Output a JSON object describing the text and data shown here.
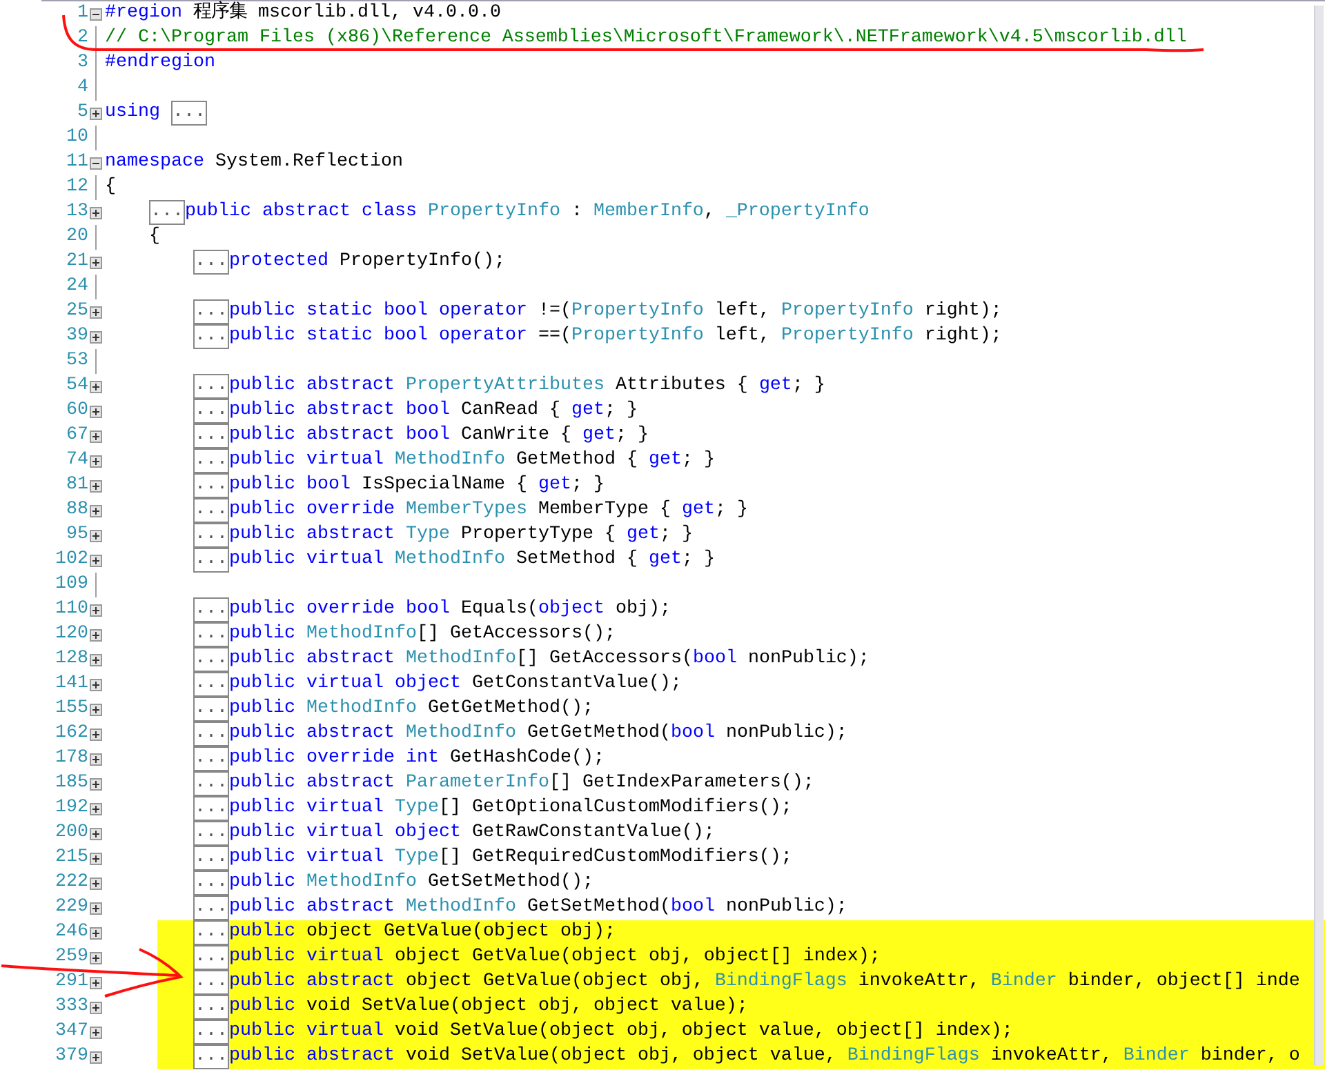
{
  "editor": {
    "lines": [
      {
        "number": "1",
        "expanded": true,
        "highlighted": false,
        "segments": [
          {
            "kind": "keyword",
            "text": "#region"
          },
          {
            "kind": "plain",
            "text": " 程序集 mscorlib.dll, v4.0.0.0"
          }
        ]
      },
      {
        "number": "2",
        "highlighted": false,
        "segments": [
          {
            "kind": "comment",
            "text": "// C:\\Program Files (x86)\\Reference Assemblies\\Microsoft\\Framework\\.NETFramework\\v4.5\\mscorlib.dll"
          }
        ]
      },
      {
        "number": "3",
        "highlighted": false,
        "segments": [
          {
            "kind": "keyword",
            "text": "#endregion"
          }
        ]
      },
      {
        "number": "4",
        "highlighted": false
      },
      {
        "number": "5",
        "expanded": false,
        "highlighted": false,
        "segments": [
          {
            "kind": "keyword",
            "text": "using "
          },
          {
            "kind": "collapsed",
            "text": "..."
          }
        ]
      },
      {
        "number": "10",
        "highlighted": false
      },
      {
        "number": "11",
        "expanded": true,
        "highlighted": false,
        "segments": [
          {
            "kind": "keyword",
            "text": "namespace"
          },
          {
            "kind": "plain",
            "text": " System.Reflection"
          }
        ]
      },
      {
        "number": "12",
        "highlighted": false,
        "segments": [
          {
            "kind": "plain",
            "text": "{"
          }
        ],
        "children": [
          {
            "number": "13",
            "expanded": false,
            "highlighted": false,
            "segments": [
              {
                "kind": "collapsed",
                "text": "..."
              },
              {
                "kind": "keyword",
                "text": "public abstract class "
              },
              {
                "kind": "type",
                "text": "PropertyInfo"
              },
              {
                "kind": "plain",
                "text": " : "
              },
              {
                "kind": "type",
                "text": "MemberInfo"
              },
              {
                "kind": "plain",
                "text": ", "
              },
              {
                "kind": "type",
                "text": "_PropertyInfo"
              }
            ]
          },
          {
            "number": "20",
            "highlighted": false,
            "segments": [
              {
                "kind": "plain",
                "text": "{"
              }
            ],
            "children": [
              {
                "number": "21",
                "expanded": false,
                "highlighted": false,
                "segments": [
                  {
                    "kind": "collapsed",
                    "text": "..."
                  },
                  {
                    "kind": "keyword",
                    "text": "protected"
                  },
                  {
                    "kind": "plain",
                    "text": " PropertyInfo();"
                  }
                ]
              },
              {
                "number": "24",
                "highlighted": false
              },
              {
                "number": "25",
                "expanded": false,
                "highlighted": false,
                "segments": [
                  {
                    "kind": "collapsed",
                    "text": "..."
                  },
                  {
                    "kind": "keyword",
                    "text": "public static bool operator"
                  },
                  {
                    "kind": "plain",
                    "text": " !=("
                  },
                  {
                    "kind": "type",
                    "text": "PropertyInfo"
                  },
                  {
                    "kind": "plain",
                    "text": " left, "
                  },
                  {
                    "kind": "type",
                    "text": "PropertyInfo"
                  },
                  {
                    "kind": "plain",
                    "text": " right);"
                  }
                ]
              },
              {
                "number": "39",
                "expanded": false,
                "highlighted": false,
                "segments": [
                  {
                    "kind": "collapsed",
                    "text": "..."
                  },
                  {
                    "kind": "keyword",
                    "text": "public static bool operator"
                  },
                  {
                    "kind": "plain",
                    "text": " ==("
                  },
                  {
                    "kind": "type",
                    "text": "PropertyInfo"
                  },
                  {
                    "kind": "plain",
                    "text": " left, "
                  },
                  {
                    "kind": "type",
                    "text": "PropertyInfo"
                  },
                  {
                    "kind": "plain",
                    "text": " right);"
                  }
                ]
              },
              {
                "number": "53",
                "highlighted": false
              },
              {
                "number": "54",
                "expanded": false,
                "highlighted": false,
                "segments": [
                  {
                    "kind": "collapsed",
                    "text": "..."
                  },
                  {
                    "kind": "keyword",
                    "text": "public abstract "
                  },
                  {
                    "kind": "type",
                    "text": "PropertyAttributes"
                  },
                  {
                    "kind": "plain",
                    "text": " Attributes { "
                  },
                  {
                    "kind": "keyword",
                    "text": "get"
                  },
                  {
                    "kind": "plain",
                    "text": "; }"
                  }
                ]
              },
              {
                "number": "60",
                "expanded": false,
                "highlighted": false,
                "segments": [
                  {
                    "kind": "collapsed",
                    "text": "..."
                  },
                  {
                    "kind": "keyword",
                    "text": "public abstract bool"
                  },
                  {
                    "kind": "plain",
                    "text": " CanRead { "
                  },
                  {
                    "kind": "keyword",
                    "text": "get"
                  },
                  {
                    "kind": "plain",
                    "text": "; }"
                  }
                ]
              },
              {
                "number": "67",
                "expanded": false,
                "highlighted": false,
                "segments": [
                  {
                    "kind": "collapsed",
                    "text": "..."
                  },
                  {
                    "kind": "keyword",
                    "text": "public abstract bool"
                  },
                  {
                    "kind": "plain",
                    "text": " CanWrite { "
                  },
                  {
                    "kind": "keyword",
                    "text": "get"
                  },
                  {
                    "kind": "plain",
                    "text": "; }"
                  }
                ]
              },
              {
                "number": "74",
                "expanded": false,
                "highlighted": false,
                "segments": [
                  {
                    "kind": "collapsed",
                    "text": "..."
                  },
                  {
                    "kind": "keyword",
                    "text": "public virtual "
                  },
                  {
                    "kind": "type",
                    "text": "MethodInfo"
                  },
                  {
                    "kind": "plain",
                    "text": " GetMethod { "
                  },
                  {
                    "kind": "keyword",
                    "text": "get"
                  },
                  {
                    "kind": "plain",
                    "text": "; }"
                  }
                ]
              },
              {
                "number": "81",
                "expanded": false,
                "highlighted": false,
                "segments": [
                  {
                    "kind": "collapsed",
                    "text": "..."
                  },
                  {
                    "kind": "keyword",
                    "text": "public bool"
                  },
                  {
                    "kind": "plain",
                    "text": " IsSpecialName { "
                  },
                  {
                    "kind": "keyword",
                    "text": "get"
                  },
                  {
                    "kind": "plain",
                    "text": "; }"
                  }
                ]
              },
              {
                "number": "88",
                "expanded": false,
                "highlighted": false,
                "segments": [
                  {
                    "kind": "collapsed",
                    "text": "..."
                  },
                  {
                    "kind": "keyword",
                    "text": "public override "
                  },
                  {
                    "kind": "type",
                    "text": "MemberTypes"
                  },
                  {
                    "kind": "plain",
                    "text": " MemberType { "
                  },
                  {
                    "kind": "keyword",
                    "text": "get"
                  },
                  {
                    "kind": "plain",
                    "text": "; }"
                  }
                ]
              },
              {
                "number": "95",
                "expanded": false,
                "highlighted": false,
                "segments": [
                  {
                    "kind": "collapsed",
                    "text": "..."
                  },
                  {
                    "kind": "keyword",
                    "text": "public abstract "
                  },
                  {
                    "kind": "type",
                    "text": "Type"
                  },
                  {
                    "kind": "plain",
                    "text": " PropertyType { "
                  },
                  {
                    "kind": "keyword",
                    "text": "get"
                  },
                  {
                    "kind": "plain",
                    "text": "; }"
                  }
                ]
              },
              {
                "number": "102",
                "expanded": false,
                "highlighted": false,
                "segments": [
                  {
                    "kind": "collapsed",
                    "text": "..."
                  },
                  {
                    "kind": "keyword",
                    "text": "public virtual "
                  },
                  {
                    "kind": "type",
                    "text": "MethodInfo"
                  },
                  {
                    "kind": "plain",
                    "text": " SetMethod { "
                  },
                  {
                    "kind": "keyword",
                    "text": "get"
                  },
                  {
                    "kind": "plain",
                    "text": "; }"
                  }
                ]
              },
              {
                "number": "109",
                "highlighted": false
              },
              {
                "number": "110",
                "expanded": false,
                "highlighted": false,
                "segments": [
                  {
                    "kind": "collapsed",
                    "text": "..."
                  },
                  {
                    "kind": "keyword",
                    "text": "public override bool"
                  },
                  {
                    "kind": "plain",
                    "text": " Equals("
                  },
                  {
                    "kind": "keyword",
                    "text": "object"
                  },
                  {
                    "kind": "plain",
                    "text": " obj);"
                  }
                ]
              },
              {
                "number": "120",
                "expanded": false,
                "highlighted": false,
                "segments": [
                  {
                    "kind": "collapsed",
                    "text": "..."
                  },
                  {
                    "kind": "keyword",
                    "text": "public "
                  },
                  {
                    "kind": "type",
                    "text": "MethodInfo"
                  },
                  {
                    "kind": "plain",
                    "text": "[] GetAccessors();"
                  }
                ]
              },
              {
                "number": "128",
                "expanded": false,
                "highlighted": false,
                "segments": [
                  {
                    "kind": "collapsed",
                    "text": "..."
                  },
                  {
                    "kind": "keyword",
                    "text": "public abstract "
                  },
                  {
                    "kind": "type",
                    "text": "MethodInfo"
                  },
                  {
                    "kind": "plain",
                    "text": "[] GetAccessors("
                  },
                  {
                    "kind": "keyword",
                    "text": "bool"
                  },
                  {
                    "kind": "plain",
                    "text": " nonPublic);"
                  }
                ]
              },
              {
                "number": "141",
                "expanded": false,
                "highlighted": false,
                "segments": [
                  {
                    "kind": "collapsed",
                    "text": "..."
                  },
                  {
                    "kind": "keyword",
                    "text": "public virtual object"
                  },
                  {
                    "kind": "plain",
                    "text": " GetConstantValue();"
                  }
                ]
              },
              {
                "number": "155",
                "expanded": false,
                "highlighted": false,
                "segments": [
                  {
                    "kind": "collapsed",
                    "text": "..."
                  },
                  {
                    "kind": "keyword",
                    "text": "public "
                  },
                  {
                    "kind": "type",
                    "text": "MethodInfo"
                  },
                  {
                    "kind": "plain",
                    "text": " GetGetMethod();"
                  }
                ]
              },
              {
                "number": "162",
                "expanded": false,
                "highlighted": false,
                "segments": [
                  {
                    "kind": "collapsed",
                    "text": "..."
                  },
                  {
                    "kind": "keyword",
                    "text": "public abstract "
                  },
                  {
                    "kind": "type",
                    "text": "MethodInfo"
                  },
                  {
                    "kind": "plain",
                    "text": " GetGetMethod("
                  },
                  {
                    "kind": "keyword",
                    "text": "bool"
                  },
                  {
                    "kind": "plain",
                    "text": " nonPublic);"
                  }
                ]
              },
              {
                "number": "178",
                "expanded": false,
                "highlighted": false,
                "segments": [
                  {
                    "kind": "collapsed",
                    "text": "..."
                  },
                  {
                    "kind": "keyword",
                    "text": "public override int"
                  },
                  {
                    "kind": "plain",
                    "text": " GetHashCode();"
                  }
                ]
              },
              {
                "number": "185",
                "expanded": false,
                "highlighted": false,
                "segments": [
                  {
                    "kind": "collapsed",
                    "text": "..."
                  },
                  {
                    "kind": "keyword",
                    "text": "public abstract "
                  },
                  {
                    "kind": "type",
                    "text": "ParameterInfo"
                  },
                  {
                    "kind": "plain",
                    "text": "[] GetIndexParameters();"
                  }
                ]
              },
              {
                "number": "192",
                "expanded": false,
                "highlighted": false,
                "segments": [
                  {
                    "kind": "collapsed",
                    "text": "..."
                  },
                  {
                    "kind": "keyword",
                    "text": "public virtual "
                  },
                  {
                    "kind": "type",
                    "text": "Type"
                  },
                  {
                    "kind": "plain",
                    "text": "[] GetOptionalCustomModifiers();"
                  }
                ]
              },
              {
                "number": "200",
                "expanded": false,
                "highlighted": false,
                "segments": [
                  {
                    "kind": "collapsed",
                    "text": "..."
                  },
                  {
                    "kind": "keyword",
                    "text": "public virtual object"
                  },
                  {
                    "kind": "plain",
                    "text": " GetRawConstantValue();"
                  }
                ]
              },
              {
                "number": "215",
                "expanded": false,
                "highlighted": false,
                "segments": [
                  {
                    "kind": "collapsed",
                    "text": "..."
                  },
                  {
                    "kind": "keyword",
                    "text": "public virtual "
                  },
                  {
                    "kind": "type",
                    "text": "Type"
                  },
                  {
                    "kind": "plain",
                    "text": "[] GetRequiredCustomModifiers();"
                  }
                ]
              },
              {
                "number": "222",
                "expanded": false,
                "highlighted": false,
                "segments": [
                  {
                    "kind": "collapsed",
                    "text": "..."
                  },
                  {
                    "kind": "keyword",
                    "text": "public "
                  },
                  {
                    "kind": "type",
                    "text": "MethodInfo"
                  },
                  {
                    "kind": "plain",
                    "text": " GetSetMethod();"
                  }
                ]
              },
              {
                "number": "229",
                "expanded": false,
                "highlighted": false,
                "segments": [
                  {
                    "kind": "collapsed",
                    "text": "..."
                  },
                  {
                    "kind": "keyword",
                    "text": "public abstract "
                  },
                  {
                    "kind": "type",
                    "text": "MethodInfo"
                  },
                  {
                    "kind": "plain",
                    "text": " GetSetMethod("
                  },
                  {
                    "kind": "keyword",
                    "text": "bool"
                  },
                  {
                    "kind": "plain",
                    "text": " nonPublic);"
                  }
                ]
              },
              {
                "number": "246",
                "expanded": false,
                "highlighted": true,
                "segments": [
                  {
                    "kind": "collapsed",
                    "text": "..."
                  },
                  {
                    "kind": "keyword",
                    "text": "public"
                  },
                  {
                    "kind": "plain",
                    "text": " object GetValue(object obj);"
                  }
                ]
              },
              {
                "number": "259",
                "expanded": false,
                "highlighted": true,
                "segments": [
                  {
                    "kind": "collapsed",
                    "text": "..."
                  },
                  {
                    "kind": "keyword",
                    "text": "public virtual"
                  },
                  {
                    "kind": "plain",
                    "text": " object GetValue(object obj, object[] index);"
                  }
                ]
              },
              {
                "number": "291",
                "expanded": false,
                "highlighted": true,
                "segments": [
                  {
                    "kind": "collapsed",
                    "text": "..."
                  },
                  {
                    "kind": "keyword",
                    "text": "public abstract"
                  },
                  {
                    "kind": "plain",
                    "text": " object GetValue(object obj, "
                  },
                  {
                    "kind": "type",
                    "text": "BindingFlags"
                  },
                  {
                    "kind": "plain",
                    "text": " invokeAttr, "
                  },
                  {
                    "kind": "type",
                    "text": "Binder"
                  },
                  {
                    "kind": "plain",
                    "text": " binder, object[] inde"
                  }
                ]
              },
              {
                "number": "333",
                "expanded": false,
                "highlighted": true,
                "segments": [
                  {
                    "kind": "collapsed",
                    "text": "..."
                  },
                  {
                    "kind": "keyword",
                    "text": "public"
                  },
                  {
                    "kind": "plain",
                    "text": " void SetValue(object obj, object value);"
                  }
                ]
              },
              {
                "number": "347",
                "expanded": false,
                "highlighted": true,
                "segments": [
                  {
                    "kind": "collapsed",
                    "text": "..."
                  },
                  {
                    "kind": "keyword",
                    "text": "public virtual"
                  },
                  {
                    "kind": "plain",
                    "text": " void SetValue(object obj, object value, object[] index);"
                  }
                ]
              },
              {
                "number": "379",
                "expanded": false,
                "highlighted": true,
                "segments": [
                  {
                    "kind": "collapsed",
                    "text": "..."
                  },
                  {
                    "kind": "keyword",
                    "text": "public abstract"
                  },
                  {
                    "kind": "plain",
                    "text": " void SetValue(object obj, object value, "
                  },
                  {
                    "kind": "type",
                    "text": "BindingFlags"
                  },
                  {
                    "kind": "plain",
                    "text": " invokeAttr, "
                  },
                  {
                    "kind": "type",
                    "text": "Binder"
                  },
                  {
                    "kind": "plain",
                    "text": " binder, o"
                  }
                ]
              }
            ]
          }
        ]
      }
    ]
  }
}
